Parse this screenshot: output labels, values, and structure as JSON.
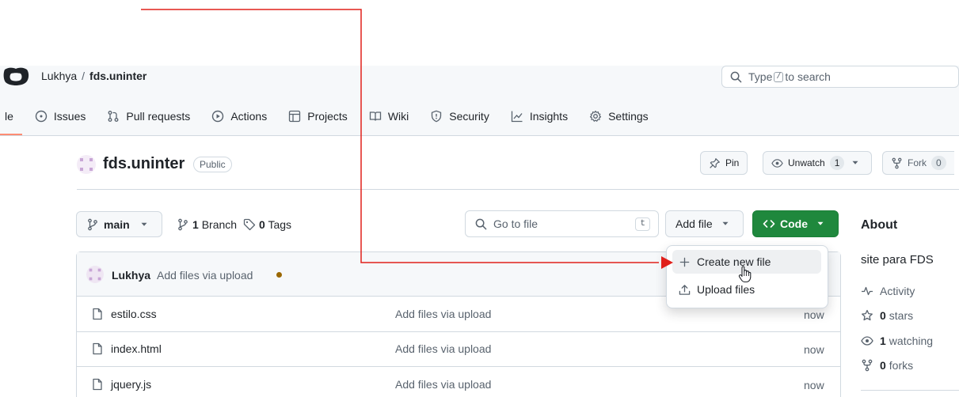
{
  "header": {
    "owner": "Lukhya",
    "separator": "/",
    "repo": "fds.uninter",
    "search_prefix": "Type",
    "search_key": "/",
    "search_suffix": "to search"
  },
  "nav": {
    "code_cut": "le",
    "tabs": [
      {
        "label": "Issues"
      },
      {
        "label": "Pull requests"
      },
      {
        "label": "Actions"
      },
      {
        "label": "Projects"
      },
      {
        "label": "Wiki"
      },
      {
        "label": "Security"
      },
      {
        "label": "Insights"
      },
      {
        "label": "Settings"
      }
    ],
    "active_color": "#fd8c73"
  },
  "repo_title": {
    "name": "fds.uninter",
    "visibility": "Public",
    "pin_label": "Pin",
    "unwatch_label": "Unwatch",
    "unwatch_count": "1",
    "fork_label": "Fork",
    "fork_count": "0"
  },
  "toolbar": {
    "branch": "main",
    "branches_count": "1",
    "branches_label": "Branch",
    "tags_count": "0",
    "tags_label": "Tags",
    "goto_placeholder": "Go to file",
    "goto_key": "t",
    "addfile_label": "Add file",
    "code_label": "Code",
    "code_color": "#1f883d"
  },
  "commit": {
    "author": "Lukhya",
    "message": "Add files via upload",
    "status_color": "#9a6700"
  },
  "files": [
    {
      "name": "estilo.css",
      "message": "Add files via upload",
      "time": "now"
    },
    {
      "name": "index.html",
      "message": "Add files via upload",
      "time": "now"
    },
    {
      "name": "jquery.js",
      "message": "Add files via upload",
      "time": "now"
    }
  ],
  "add_file_menu": {
    "items": [
      {
        "label": "Create new file",
        "icon": "plus-icon"
      },
      {
        "label": "Upload files",
        "icon": "upload-icon"
      }
    ]
  },
  "about": {
    "heading": "About",
    "description": "site para FDS",
    "activity_label": "Activity",
    "stars_count": "0",
    "stars_label": "stars",
    "watching_count": "1",
    "watching_label": "watching",
    "forks_count": "0",
    "forks_label": "forks"
  },
  "annotation": {
    "arrow_color": "#e0201b"
  }
}
